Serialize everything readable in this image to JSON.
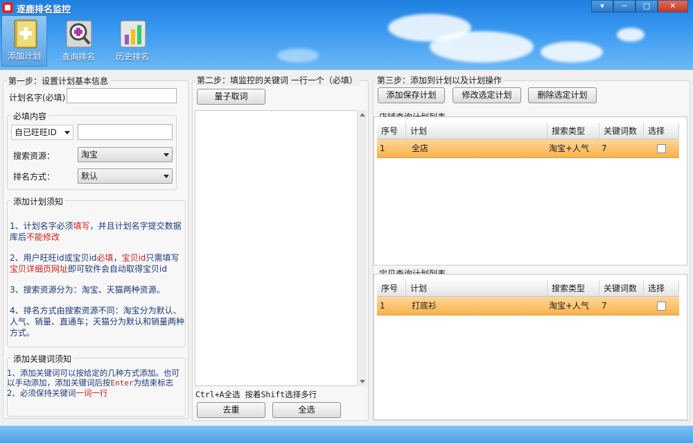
{
  "app": {
    "title": "逐鹿排名监控"
  },
  "toolbar": [
    {
      "label": "添加计划",
      "icon": "add-plan-icon",
      "active": true
    },
    {
      "label": "查询排名",
      "icon": "search-rank-icon",
      "active": false
    },
    {
      "label": "历史排名",
      "icon": "history-rank-icon",
      "active": false
    }
  ],
  "window_controls": {
    "dropdown": "▾",
    "minimize": "−",
    "maximize": "□",
    "close": "✕"
  },
  "step1": {
    "title": "第一步：设置计划基本信息",
    "plan_name_label": "计划名字(必填)",
    "plan_name_value": "",
    "required": {
      "title": "必填内容",
      "id_type": "自已旺旺ID",
      "id_value": "",
      "source_label": "搜索资源：",
      "source_value": "淘宝",
      "rank_label": "排名方式：",
      "rank_value": "默认"
    },
    "notes_title": "添加计划须知",
    "note1_a": "1、计划名字必须",
    "note1_b": "填写",
    "note1_c": "，并且计划名字提交数据库后",
    "note1_d": "不能修改",
    "note2_a": "2、用户旺旺id或宝贝id",
    "note2_b": "必填",
    "note2_c": "，",
    "note2_d": "宝贝id",
    "note2_e": "只需填写",
    "note2_f": "宝贝详细页网址",
    "note2_g": "即可软件会自动取得宝贝id",
    "note3": "3、搜索资源分为：淘宝、天猫两种资源。",
    "note4": "4、排名方式由搜索资源不同：淘宝分为默认、人气、销量、直通车；天猫分为默认和销量两种方式。",
    "kw_notes_title": "添加关键词须知",
    "kw1_a": "1、添加关键词可以按给定的几种方式添加。也可以手动添加，添加关键词后按",
    "kw1_key": "Enter",
    "kw1_b": "为结束标志",
    "kw2_a": "2、必须保持关键词",
    "kw2_b": "一词一行"
  },
  "step2": {
    "title": "第二步：填监控的关键词 一行一个（必填）",
    "fetch_button": "量子取词",
    "keywords": "",
    "hint": "Ctrl+A全选 按着Shift选择多行",
    "dedupe_button": "去重",
    "select_all_button": "全选"
  },
  "step3": {
    "title": "第三步：添加到计划以及计划操作",
    "add_button": "添加保存计划",
    "edit_button": "修改选定计划",
    "delete_button": "删除选定计划",
    "store_list": {
      "title": "店铺查询计划列表",
      "columns": [
        "序号",
        "计划",
        "搜索类型",
        "关键词数",
        "选择"
      ],
      "rows": [
        {
          "no": "1",
          "plan": "全店",
          "type": "淘宝+人气",
          "count": "7",
          "checked": false
        }
      ]
    },
    "item_list": {
      "title": "宝贝查询计划列表",
      "columns": [
        "序号",
        "计划",
        "搜索类型",
        "关键词数",
        "选择"
      ],
      "rows": [
        {
          "no": "1",
          "plan": "打底衫",
          "type": "淘宝+人气",
          "count": "7",
          "checked": false
        }
      ]
    }
  },
  "colors": {
    "sky": "#3a9af0",
    "row_highlight": "#f9b24b",
    "note_text": "#1e3a78",
    "note_red": "#d21c1c"
  }
}
